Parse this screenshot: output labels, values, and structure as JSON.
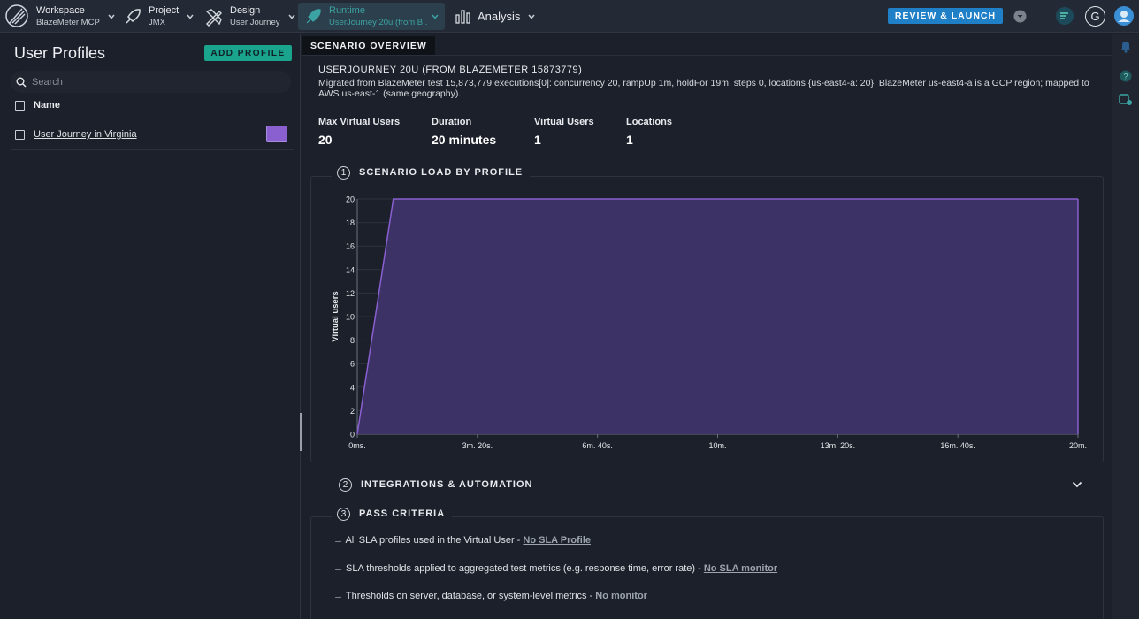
{
  "topbar": {
    "workspace": {
      "title": "Workspace",
      "sub": "BlazeMeter MCP"
    },
    "project": {
      "title": "Project",
      "sub": "JMX"
    },
    "design": {
      "title": "Design",
      "sub": "User Journey"
    },
    "runtime": {
      "title": "Runtime",
      "sub": "UserJourney 20u (from B..."
    },
    "analysis": {
      "title": "Analysis"
    },
    "review_launch": "REVIEW & LAUNCH",
    "avatar_letter": "G"
  },
  "left": {
    "title": "User Profiles",
    "add_profile": "ADD PROFILE",
    "search_placeholder": "Search",
    "column_name": "Name",
    "profiles": [
      {
        "name": "User Journey in Virginia",
        "color": "#8a5fd0"
      }
    ]
  },
  "main": {
    "tab": "SCENARIO OVERVIEW",
    "scenario_name": "USERJOURNEY 20U (FROM BLAZEMETER 15873779)",
    "scenario_desc": "Migrated from BlazeMeter test 15,873,779 executions[0]: concurrency 20, rampUp 1m, holdFor 19m, steps 0, locations {us-east4-a: 20}. BlazeMeter us-east4-a is a GCP region; mapped to AWS us-east-1 (same geography).",
    "stats": [
      {
        "label": "Max Virtual Users",
        "value": "20"
      },
      {
        "label": "Duration",
        "value": "20 minutes"
      },
      {
        "label": "Virtual Users",
        "value": "1"
      },
      {
        "label": "Locations",
        "value": "1"
      }
    ],
    "sections": [
      {
        "num": "1",
        "title": "SCENARIO LOAD BY PROFILE"
      },
      {
        "num": "2",
        "title": "INTEGRATIONS & AUTOMATION"
      },
      {
        "num": "3",
        "title": "PASS CRITERIA"
      }
    ],
    "criteria": [
      {
        "text": "→ All SLA profiles used in the Virtual User - ",
        "link": "No SLA Profile"
      },
      {
        "text": "→ SLA thresholds applied to aggregated test metrics (e.g. response time, error rate) - ",
        "link": "No SLA monitor"
      },
      {
        "text": "→ Thresholds on server, database, or system-level metrics - ",
        "link": "No monitor"
      }
    ]
  },
  "colors": {
    "accent": "#1f7fc7",
    "teal": "#1aa38d",
    "series": "#8a5fd0"
  },
  "chart_data": {
    "type": "area",
    "ylabel": "Virtual users",
    "xlabel": "",
    "x_ticks": [
      "0ms.",
      "3m. 20s.",
      "6m. 40s.",
      "10m.",
      "13m. 20s.",
      "16m. 40s.",
      "20m."
    ],
    "x_minutes": [
      0,
      1,
      20
    ],
    "y": [
      0,
      20,
      20
    ],
    "ylim": [
      0,
      20
    ],
    "y_ticks": [
      0,
      2,
      4,
      6,
      8,
      10,
      12,
      14,
      16,
      18,
      20
    ],
    "xlim_minutes": [
      0,
      20
    ],
    "grid": true
  }
}
